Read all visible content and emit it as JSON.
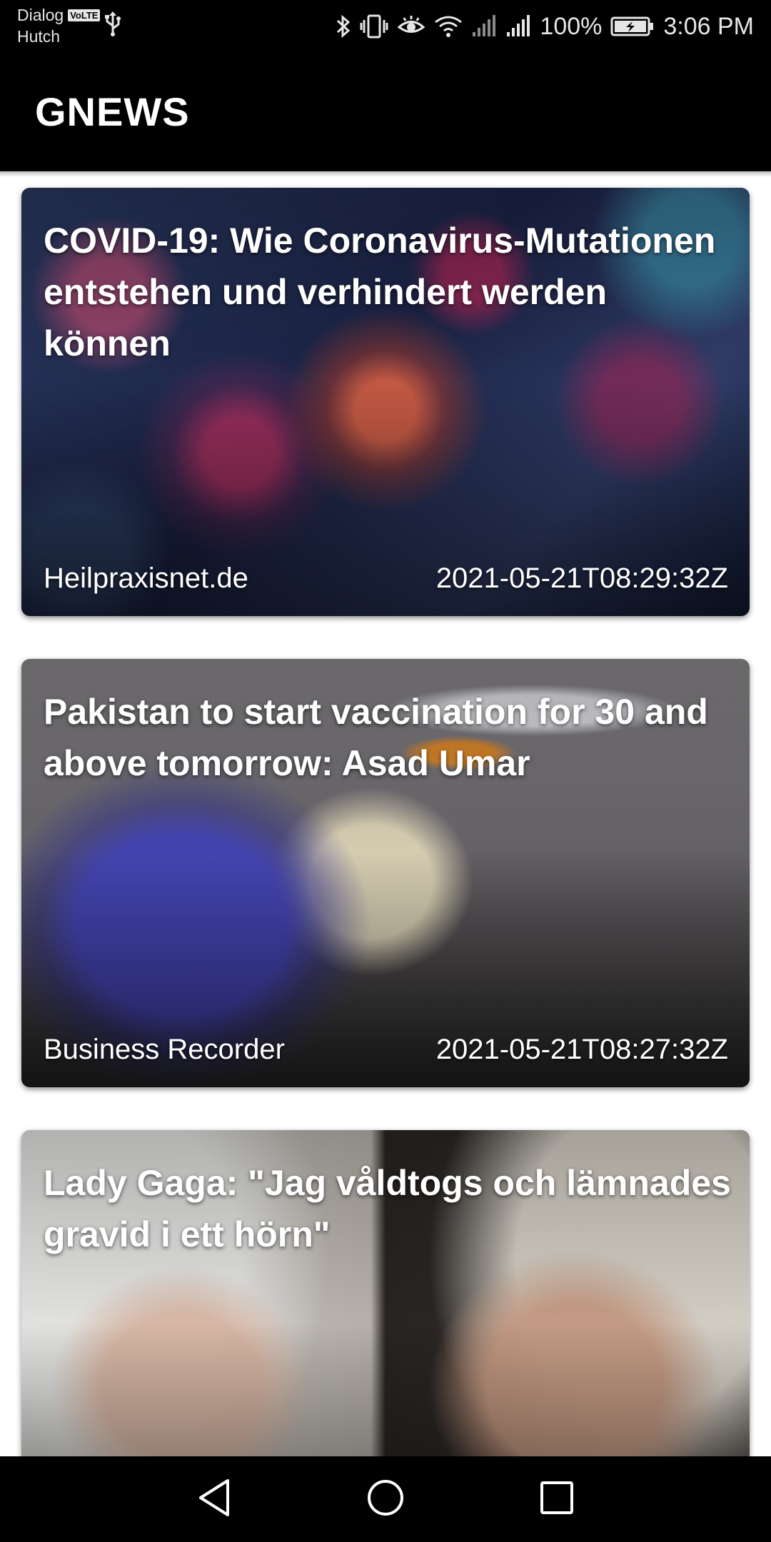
{
  "status_bar": {
    "carrier_1": "Dialog",
    "volte_badge": "VoLTE",
    "carrier_2": "Hutch",
    "battery_percent": "100%",
    "time": "3:06 PM",
    "icons": [
      "usb-icon",
      "bluetooth-icon",
      "vibrate-icon",
      "eye-comfort-icon",
      "wifi-icon",
      "signal-icon",
      "signal-icon",
      "battery-charging-icon"
    ]
  },
  "app_bar": {
    "title": "GNEWS"
  },
  "articles": [
    {
      "title": "COVID-19: Wie Coronavirus-Mutationen entstehen und verhindert werden können",
      "source": "Heilpraxisnet.de",
      "published_at": "2021-05-21T08:29:32Z"
    },
    {
      "title": "Pakistan to start vaccination for 30 and above tomorrow: Asad Umar",
      "source": "Business Recorder",
      "published_at": "2021-05-21T08:27:32Z"
    },
    {
      "title": "Lady Gaga: \"Jag våldtogs och lämnades gravid i ett hörn\"",
      "source": "",
      "published_at": ""
    }
  ],
  "nav_bar": {
    "icons": [
      "back-icon",
      "home-icon",
      "recents-icon"
    ]
  },
  "colors": {
    "app_bar": "#000000",
    "background": "#ffffff",
    "card_text": "#ffffff"
  }
}
